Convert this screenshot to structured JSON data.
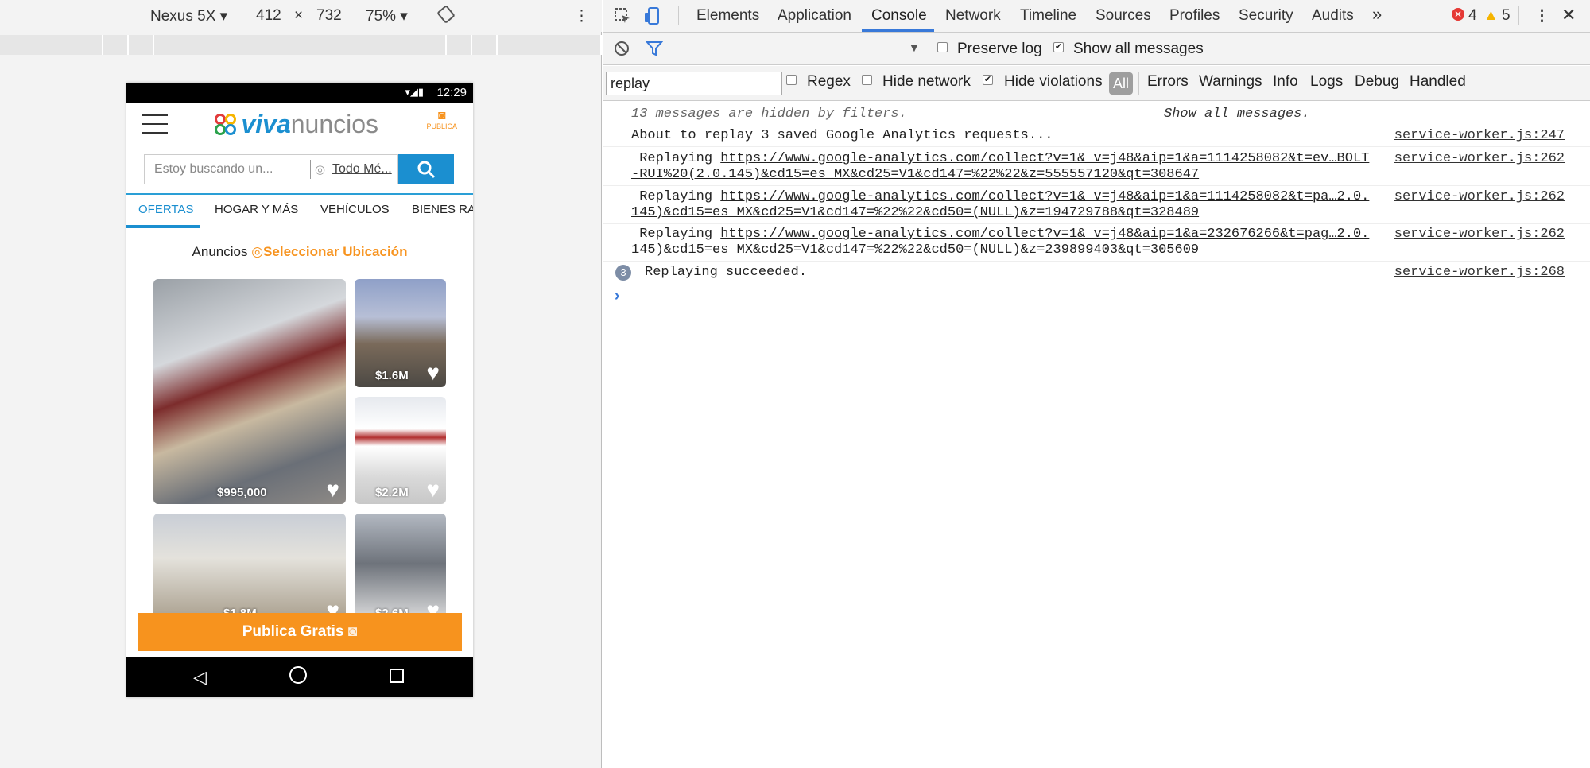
{
  "device_toolbar": {
    "device": "Nexus 5X",
    "width": "412",
    "times": "×",
    "height": "732",
    "zoom": "75%"
  },
  "phone": {
    "status_time": "12:29",
    "logo_part1": "viva",
    "logo_part2": "nuncios",
    "publica_label": "PUBLICA",
    "search_placeholder": "Estoy buscando un...",
    "location_text": "Todo Mé...",
    "tabs": [
      "OFERTAS",
      "HOGAR Y MÁS",
      "VEHÍCULOS",
      "BIENES RAÍ"
    ],
    "ads_label": "Anuncios",
    "select_location": "Seleccionar Ubicación",
    "cards": [
      {
        "price": "$995,000"
      },
      {
        "price": "$1.6M"
      },
      {
        "price": "$2.2M"
      },
      {
        "price": "$1.8M"
      },
      {
        "price": "$2.6M"
      }
    ],
    "publish_button": "Publica Gratis"
  },
  "devtools": {
    "panels": [
      "Elements",
      "Application",
      "Console",
      "Network",
      "Timeline",
      "Sources",
      "Profiles",
      "Security",
      "Audits"
    ],
    "active_panel": "Console",
    "more_panels": "»",
    "error_count": "4",
    "warning_count": "5",
    "console_toolbar": {
      "preserve_log": "Preserve log",
      "show_all_messages": "Show all messages"
    },
    "filter": {
      "value": "replay",
      "regex": "Regex",
      "hide_network": "Hide network",
      "hide_violations": "Hide violations",
      "levels": [
        "All",
        "Errors",
        "Warnings",
        "Info",
        "Logs",
        "Debug",
        "Handled"
      ]
    },
    "hidden_notice": "13 messages are hidden by filters.",
    "show_all_link": "Show all messages.",
    "messages": [
      {
        "text": "About to replay 3 saved Google Analytics requests...",
        "source": "service-worker.js:247"
      },
      {
        "prefix": " Replaying ",
        "url": "https://www.google-analytics.com/collect?v=1&_v=j48&aip=1&a=1114258082&t=ev…BOLT",
        "url2": "-RUI%20(2.0.145)&cd15=es_MX&cd25=V1&cd147=%22%22&z=555557120&qt=308647",
        "source": "service-worker.js:262"
      },
      {
        "prefix": " Replaying ",
        "url": "https://www.google-analytics.com/collect?v=1&_v=j48&aip=1&a=1114258082&t=pa…2.0.",
        "url2": "145)&cd15=es_MX&cd25=V1&cd147=%22%22&cd50=(NULL)&z=194729788&qt=328489",
        "source": "service-worker.js:262"
      },
      {
        "prefix": " Replaying ",
        "url": "https://www.google-analytics.com/collect?v=1&_v=j48&aip=1&a=232676266&t=pag…2.0.",
        "url2": "145)&cd15=es_MX&cd25=V1&cd147=%22%22&cd50=(NULL)&z=239899403&qt=305609",
        "source": "service-worker.js:262"
      },
      {
        "count": "3",
        "text": "Replaying succeeded.",
        "source": "service-worker.js:268"
      }
    ],
    "prompt": "›"
  },
  "colors": {
    "accent_blue": "#1b8fd0",
    "publish_orange": "#f7931e",
    "devtools_blue": "#3879d9"
  }
}
